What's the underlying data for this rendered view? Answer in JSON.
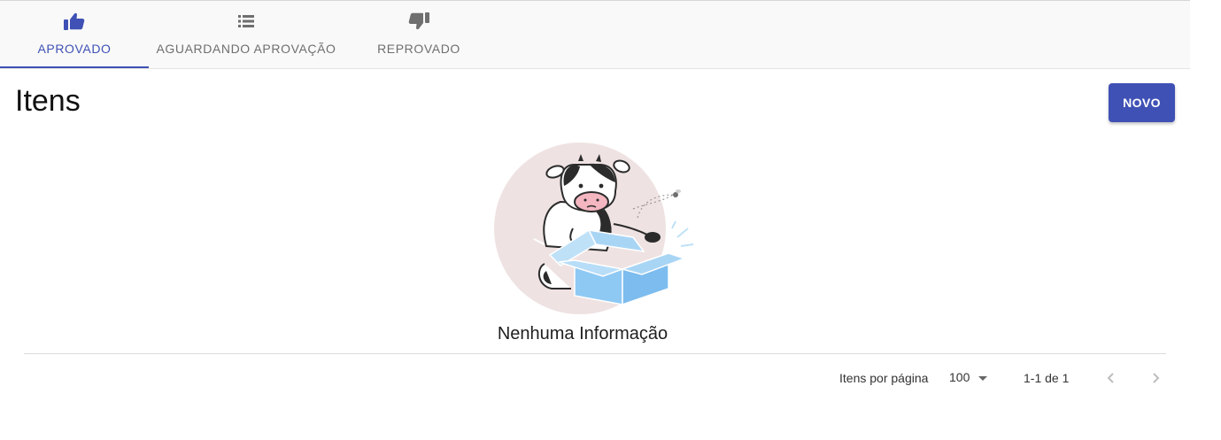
{
  "tabs": [
    {
      "label": "APROVADO",
      "icon": "thumb-up-icon",
      "active": true
    },
    {
      "label": "AGUARDANDO APROVAÇÃO",
      "icon": "list-icon",
      "active": false
    },
    {
      "label": "REPROVADO",
      "icon": "thumb-down-icon",
      "active": false
    }
  ],
  "page": {
    "title": "Itens",
    "new_button": "NOVO"
  },
  "empty_state": {
    "message": "Nenhuma Informação",
    "illustration": "cow-in-box-illustration"
  },
  "paginator": {
    "items_per_page_label": "Itens por página",
    "items_per_page_value": "100",
    "range_label": "1-1 de 1"
  },
  "colors": {
    "primary": "#3f51b5",
    "tab_inactive": "#6f6f6f",
    "tabbar_bg": "#f9f9f9"
  }
}
